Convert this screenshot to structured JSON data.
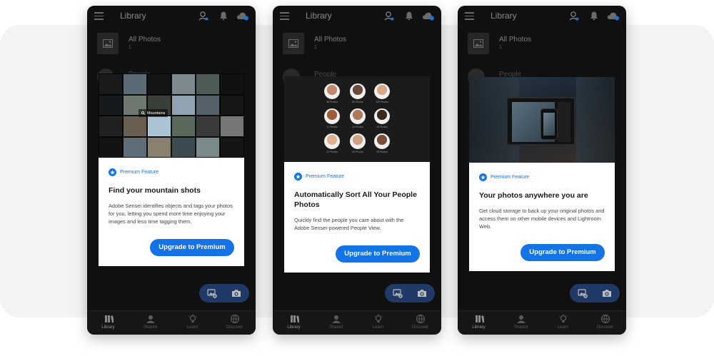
{
  "app": {
    "title": "Library",
    "album_name": "All Photos",
    "album_count": "1",
    "behind_album": "People"
  },
  "nav": {
    "tabs": [
      {
        "label": "Library",
        "icon": "library-icon",
        "active": true
      },
      {
        "label": "Shared",
        "icon": "shared-icon",
        "active": false
      },
      {
        "label": "Learn",
        "icon": "learn-icon",
        "active": false
      },
      {
        "label": "Discover",
        "icon": "discover-icon",
        "active": false
      }
    ]
  },
  "cards": [
    {
      "badge": "Premium Feature",
      "title": "Find your mountain shots",
      "description": "Adobe Sensei identifies objects and tags your photos for you, letting you spend more time enjoying your images and less time tagging them.",
      "button": "Upgrade to Premium",
      "search_tag": "Mountains"
    },
    {
      "badge": "Premium Feature",
      "title": "Automatically Sort All Your People Photos",
      "description": "Quickly find the people you care about with the Adobe Sensei-powered People View.",
      "button": "Upgrade to Premium",
      "faces": [
        "98 Photos",
        "80 Photos",
        "120 Photos",
        "71 Photos",
        "44 Photos",
        "18 Photos",
        "22 Photos",
        "45 Photos",
        "28 Photos"
      ]
    },
    {
      "badge": "Premium Feature",
      "title": "Your photos anywhere you are",
      "description": "Get cloud storage to back up your original photos and access them on other mobile devices and Lightroom Web.",
      "button": "Upgrade to Premium"
    }
  ],
  "colors": {
    "accent": "#1473e6",
    "fab": "#1f3a66",
    "phone": "#101010"
  }
}
